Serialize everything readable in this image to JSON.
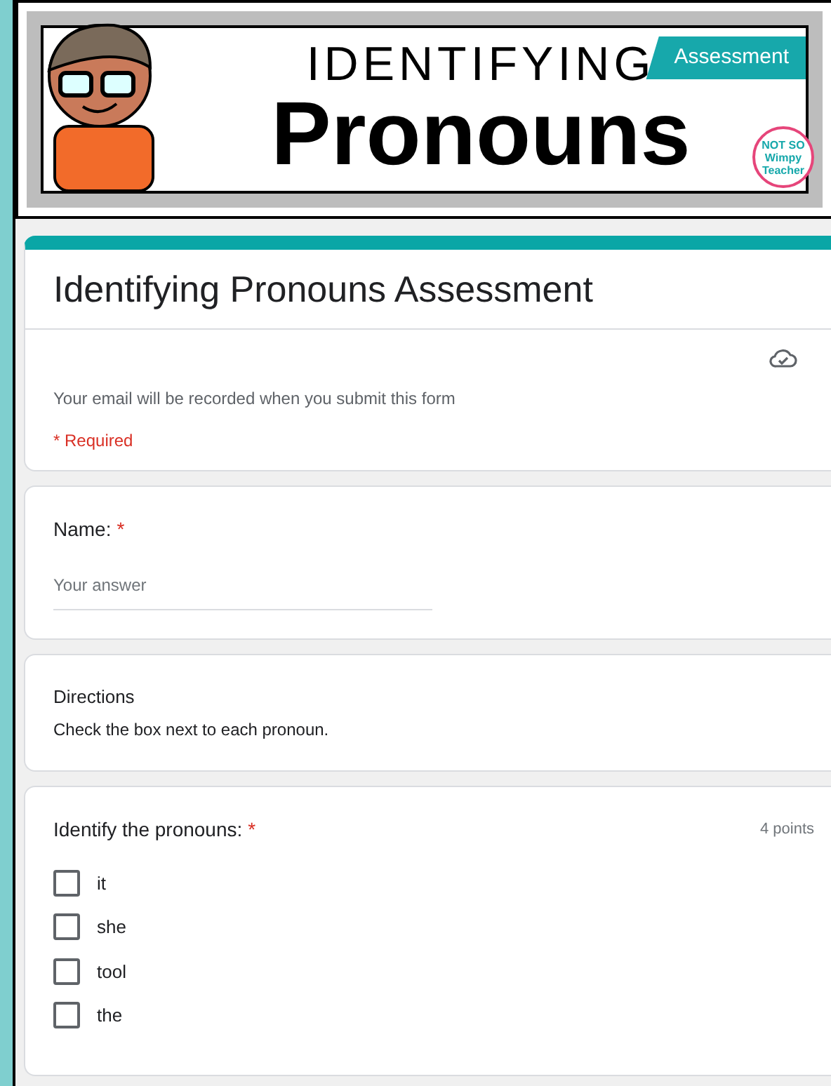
{
  "banner": {
    "small_title": "IDENTIFYING",
    "big_title": "Pronouns",
    "tag": "Assessment",
    "logo": "NOT SO Wimpy Teacher"
  },
  "form": {
    "title": "Identifying Pronouns Assessment",
    "email_note": "Your email will be recorded when you submit this form",
    "required_note": "* Required"
  },
  "name_question": {
    "label": "Name:",
    "required": true,
    "required_mark": "*",
    "placeholder": "Your answer"
  },
  "directions": {
    "title": "Directions",
    "text": "Check the box next to each pronoun."
  },
  "question": {
    "label": "Identify the pronouns:",
    "required": true,
    "required_mark": "*",
    "points": "4 points",
    "options": [
      {
        "label": "it",
        "checked": false
      },
      {
        "label": "she",
        "checked": false
      },
      {
        "label": "tool",
        "checked": false
      },
      {
        "label": "the",
        "checked": false
      }
    ]
  }
}
